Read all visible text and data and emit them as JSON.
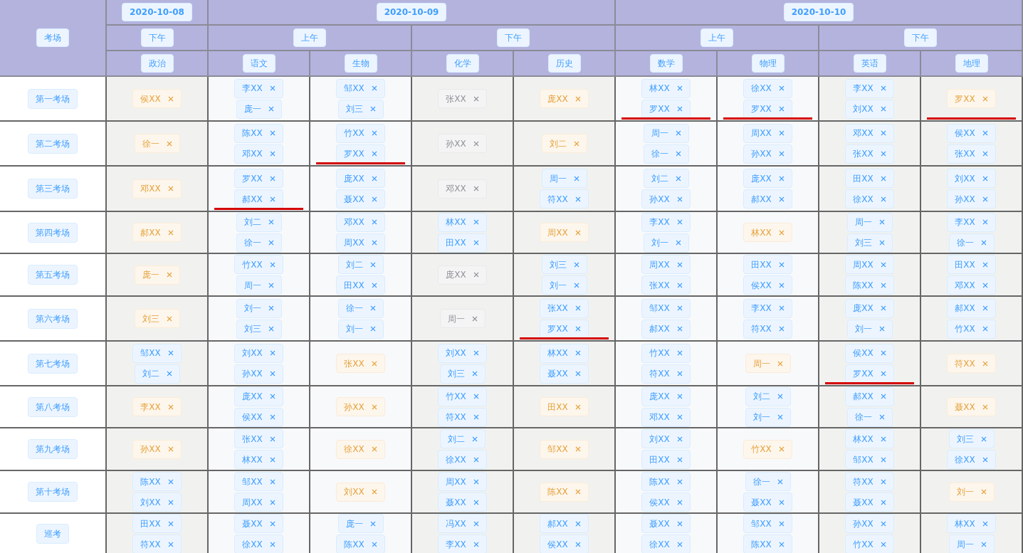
{
  "corner": "考场",
  "dates": [
    {
      "label": "2020-10-08",
      "periods": [
        {
          "label": "下午",
          "subjects": [
            "政治"
          ]
        }
      ]
    },
    {
      "label": "2020-10-09",
      "periods": [
        {
          "label": "上午",
          "subjects": [
            "语文",
            "生物"
          ]
        },
        {
          "label": "下午",
          "subjects": [
            "化学",
            "历史"
          ]
        }
      ]
    },
    {
      "label": "2020-10-10",
      "periods": [
        {
          "label": "上午",
          "subjects": [
            "数学",
            "物理"
          ]
        },
        {
          "label": "下午",
          "subjects": [
            "英语",
            "地理"
          ]
        }
      ]
    }
  ],
  "rows": [
    {
      "room": "第一考场",
      "cells": [
        {
          "kind": "warning",
          "names": [
            "侯XX"
          ],
          "underlined": false
        },
        {
          "kind": "primary",
          "names": [
            "李XX",
            "庞一"
          ],
          "underlined": false
        },
        {
          "kind": "primary",
          "names": [
            "邹XX",
            "刘三"
          ],
          "underlined": false
        },
        {
          "kind": "info",
          "names": [
            "张XX"
          ],
          "underlined": false
        },
        {
          "kind": "warning",
          "names": [
            "庞XX"
          ],
          "underlined": false
        },
        {
          "kind": "primary",
          "names": [
            "林XX",
            "罗XX"
          ],
          "underlined": true
        },
        {
          "kind": "primary",
          "names": [
            "徐XX",
            "罗XX"
          ],
          "underlined": true
        },
        {
          "kind": "primary",
          "names": [
            "李XX",
            "刘XX"
          ],
          "underlined": false
        },
        {
          "kind": "warning",
          "names": [
            "罗XX"
          ],
          "underlined": true
        }
      ]
    },
    {
      "room": "第二考场",
      "cells": [
        {
          "kind": "warning",
          "names": [
            "徐一"
          ],
          "underlined": false
        },
        {
          "kind": "primary",
          "names": [
            "陈XX",
            "邓XX"
          ],
          "underlined": false
        },
        {
          "kind": "primary",
          "names": [
            "竹XX",
            "罗XX"
          ],
          "underlined": true
        },
        {
          "kind": "info",
          "names": [
            "孙XX"
          ],
          "underlined": false
        },
        {
          "kind": "warning",
          "names": [
            "刘二"
          ],
          "underlined": false
        },
        {
          "kind": "primary",
          "names": [
            "周一",
            "徐一"
          ],
          "underlined": false
        },
        {
          "kind": "primary",
          "names": [
            "周XX",
            "孙XX"
          ],
          "underlined": false
        },
        {
          "kind": "primary",
          "names": [
            "邓XX",
            "张XX"
          ],
          "underlined": false
        },
        {
          "kind": "primary",
          "names": [
            "侯XX",
            "张XX"
          ],
          "underlined": false
        }
      ]
    },
    {
      "room": "第三考场",
      "cells": [
        {
          "kind": "warning",
          "names": [
            "邓XX"
          ],
          "underlined": false
        },
        {
          "kind": "primary",
          "names": [
            "罗XX",
            "郝XX"
          ],
          "underlined": true
        },
        {
          "kind": "primary",
          "names": [
            "庞XX",
            "聂XX"
          ],
          "underlined": false
        },
        {
          "kind": "info",
          "names": [
            "邓XX"
          ],
          "underlined": false
        },
        {
          "kind": "primary",
          "names": [
            "周一",
            "符XX"
          ],
          "underlined": false
        },
        {
          "kind": "primary",
          "names": [
            "刘二",
            "孙XX"
          ],
          "underlined": false
        },
        {
          "kind": "primary",
          "names": [
            "庞XX",
            "郝XX"
          ],
          "underlined": false
        },
        {
          "kind": "primary",
          "names": [
            "田XX",
            "徐XX"
          ],
          "underlined": false
        },
        {
          "kind": "primary",
          "names": [
            "刘XX",
            "孙XX"
          ],
          "underlined": false
        }
      ]
    },
    {
      "room": "第四考场",
      "cells": [
        {
          "kind": "warning",
          "names": [
            "郝XX"
          ],
          "underlined": false
        },
        {
          "kind": "primary",
          "names": [
            "刘二",
            "徐一"
          ],
          "underlined": false
        },
        {
          "kind": "primary",
          "names": [
            "邓XX",
            "周XX"
          ],
          "underlined": false
        },
        {
          "kind": "primary",
          "names": [
            "林XX",
            "田XX"
          ],
          "underlined": false
        },
        {
          "kind": "warning",
          "names": [
            "周XX"
          ],
          "underlined": false
        },
        {
          "kind": "primary",
          "names": [
            "李XX",
            "刘一"
          ],
          "underlined": false
        },
        {
          "kind": "warning",
          "names": [
            "林XX"
          ],
          "underlined": false
        },
        {
          "kind": "primary",
          "names": [
            "周一",
            "刘三"
          ],
          "underlined": false
        },
        {
          "kind": "primary",
          "names": [
            "李XX",
            "徐一"
          ],
          "underlined": false
        }
      ]
    },
    {
      "room": "第五考场",
      "cells": [
        {
          "kind": "warning",
          "names": [
            "庞一"
          ],
          "underlined": false
        },
        {
          "kind": "primary",
          "names": [
            "竹XX",
            "周一"
          ],
          "underlined": false
        },
        {
          "kind": "primary",
          "names": [
            "刘二",
            "田XX"
          ],
          "underlined": false
        },
        {
          "kind": "info",
          "names": [
            "庞XX"
          ],
          "underlined": false
        },
        {
          "kind": "primary",
          "names": [
            "刘三",
            "刘一"
          ],
          "underlined": false
        },
        {
          "kind": "primary",
          "names": [
            "周XX",
            "张XX"
          ],
          "underlined": false
        },
        {
          "kind": "primary",
          "names": [
            "田XX",
            "侯XX"
          ],
          "underlined": false
        },
        {
          "kind": "primary",
          "names": [
            "周XX",
            "陈XX"
          ],
          "underlined": false
        },
        {
          "kind": "primary",
          "names": [
            "田XX",
            "邓XX"
          ],
          "underlined": false
        }
      ]
    },
    {
      "room": "第六考场",
      "cells": [
        {
          "kind": "warning",
          "names": [
            "刘三"
          ],
          "underlined": false
        },
        {
          "kind": "primary",
          "names": [
            "刘一",
            "刘三"
          ],
          "underlined": false
        },
        {
          "kind": "primary",
          "names": [
            "徐一",
            "刘一"
          ],
          "underlined": false
        },
        {
          "kind": "info",
          "names": [
            "周一"
          ],
          "underlined": false
        },
        {
          "kind": "primary",
          "names": [
            "张XX",
            "罗XX"
          ],
          "underlined": true
        },
        {
          "kind": "primary",
          "names": [
            "邹XX",
            "郝XX"
          ],
          "underlined": false
        },
        {
          "kind": "primary",
          "names": [
            "李XX",
            "符XX"
          ],
          "underlined": false
        },
        {
          "kind": "primary",
          "names": [
            "庞XX",
            "刘一"
          ],
          "underlined": false
        },
        {
          "kind": "primary",
          "names": [
            "郝XX",
            "竹XX"
          ],
          "underlined": false
        }
      ]
    },
    {
      "room": "第七考场",
      "cells": [
        {
          "kind": "primary",
          "names": [
            "邹XX",
            "刘二"
          ],
          "underlined": false
        },
        {
          "kind": "primary",
          "names": [
            "刘XX",
            "孙XX"
          ],
          "underlined": false
        },
        {
          "kind": "warning",
          "names": [
            "张XX"
          ],
          "underlined": false
        },
        {
          "kind": "primary",
          "names": [
            "刘XX",
            "刘三"
          ],
          "underlined": false
        },
        {
          "kind": "primary",
          "names": [
            "林XX",
            "聂XX"
          ],
          "underlined": false
        },
        {
          "kind": "primary",
          "names": [
            "竹XX",
            "符XX"
          ],
          "underlined": false
        },
        {
          "kind": "warning",
          "names": [
            "周一"
          ],
          "underlined": false
        },
        {
          "kind": "primary",
          "names": [
            "侯XX",
            "罗XX"
          ],
          "underlined": true
        },
        {
          "kind": "warning",
          "names": [
            "符XX"
          ],
          "underlined": false
        }
      ]
    },
    {
      "room": "第八考场",
      "cells": [
        {
          "kind": "warning",
          "names": [
            "李XX"
          ],
          "underlined": false
        },
        {
          "kind": "primary",
          "names": [
            "庞XX",
            "侯XX"
          ],
          "underlined": false
        },
        {
          "kind": "warning",
          "names": [
            "孙XX"
          ],
          "underlined": false
        },
        {
          "kind": "primary",
          "names": [
            "竹XX",
            "符XX"
          ],
          "underlined": false
        },
        {
          "kind": "warning",
          "names": [
            "田XX"
          ],
          "underlined": false
        },
        {
          "kind": "primary",
          "names": [
            "庞XX",
            "邓XX"
          ],
          "underlined": false
        },
        {
          "kind": "primary",
          "names": [
            "刘二",
            "刘一"
          ],
          "underlined": false
        },
        {
          "kind": "primary",
          "names": [
            "郝XX",
            "徐一"
          ],
          "underlined": false
        },
        {
          "kind": "warning",
          "names": [
            "聂XX"
          ],
          "underlined": false
        }
      ]
    },
    {
      "room": "第九考场",
      "cells": [
        {
          "kind": "warning",
          "names": [
            "孙XX"
          ],
          "underlined": false
        },
        {
          "kind": "primary",
          "names": [
            "张XX",
            "林XX"
          ],
          "underlined": false
        },
        {
          "kind": "warning",
          "names": [
            "徐XX"
          ],
          "underlined": false
        },
        {
          "kind": "primary",
          "names": [
            "刘二",
            "徐XX"
          ],
          "underlined": false
        },
        {
          "kind": "warning",
          "names": [
            "邹XX"
          ],
          "underlined": false
        },
        {
          "kind": "primary",
          "names": [
            "刘XX",
            "田XX"
          ],
          "underlined": false
        },
        {
          "kind": "warning",
          "names": [
            "竹XX"
          ],
          "underlined": false
        },
        {
          "kind": "primary",
          "names": [
            "林XX",
            "邹XX"
          ],
          "underlined": false
        },
        {
          "kind": "primary",
          "names": [
            "刘三",
            "徐XX"
          ],
          "underlined": false
        }
      ]
    },
    {
      "room": "第十考场",
      "cells": [
        {
          "kind": "primary",
          "names": [
            "陈XX",
            "刘XX"
          ],
          "underlined": false
        },
        {
          "kind": "primary",
          "names": [
            "邹XX",
            "周XX"
          ],
          "underlined": false
        },
        {
          "kind": "warning",
          "names": [
            "刘XX"
          ],
          "underlined": false
        },
        {
          "kind": "primary",
          "names": [
            "周XX",
            "聂XX"
          ],
          "underlined": false
        },
        {
          "kind": "warning",
          "names": [
            "陈XX"
          ],
          "underlined": false
        },
        {
          "kind": "primary",
          "names": [
            "陈XX",
            "侯XX"
          ],
          "underlined": false
        },
        {
          "kind": "primary",
          "names": [
            "徐一",
            "聂XX"
          ],
          "underlined": false
        },
        {
          "kind": "primary",
          "names": [
            "符XX",
            "聂XX"
          ],
          "underlined": false
        },
        {
          "kind": "warning",
          "names": [
            "刘一"
          ],
          "underlined": false
        }
      ]
    },
    {
      "room": "巡考",
      "cells": [
        {
          "kind": "primary",
          "names": [
            "田XX",
            "符XX"
          ],
          "underlined": false
        },
        {
          "kind": "primary",
          "names": [
            "聂XX",
            "徐XX"
          ],
          "underlined": false
        },
        {
          "kind": "primary",
          "names": [
            "庞一",
            "陈XX"
          ],
          "underlined": false
        },
        {
          "kind": "primary",
          "names": [
            "冯XX",
            "李XX"
          ],
          "underlined": false
        },
        {
          "kind": "primary",
          "names": [
            "郝XX",
            "侯XX"
          ],
          "underlined": false
        },
        {
          "kind": "primary",
          "names": [
            "聂XX",
            "徐XX"
          ],
          "underlined": false
        },
        {
          "kind": "primary",
          "names": [
            "邹XX",
            "陈XX"
          ],
          "underlined": false
        },
        {
          "kind": "primary",
          "names": [
            "孙XX",
            "竹XX"
          ],
          "underlined": false
        },
        {
          "kind": "primary",
          "names": [
            "林XX",
            "周一"
          ],
          "underlined": false
        }
      ]
    }
  ]
}
